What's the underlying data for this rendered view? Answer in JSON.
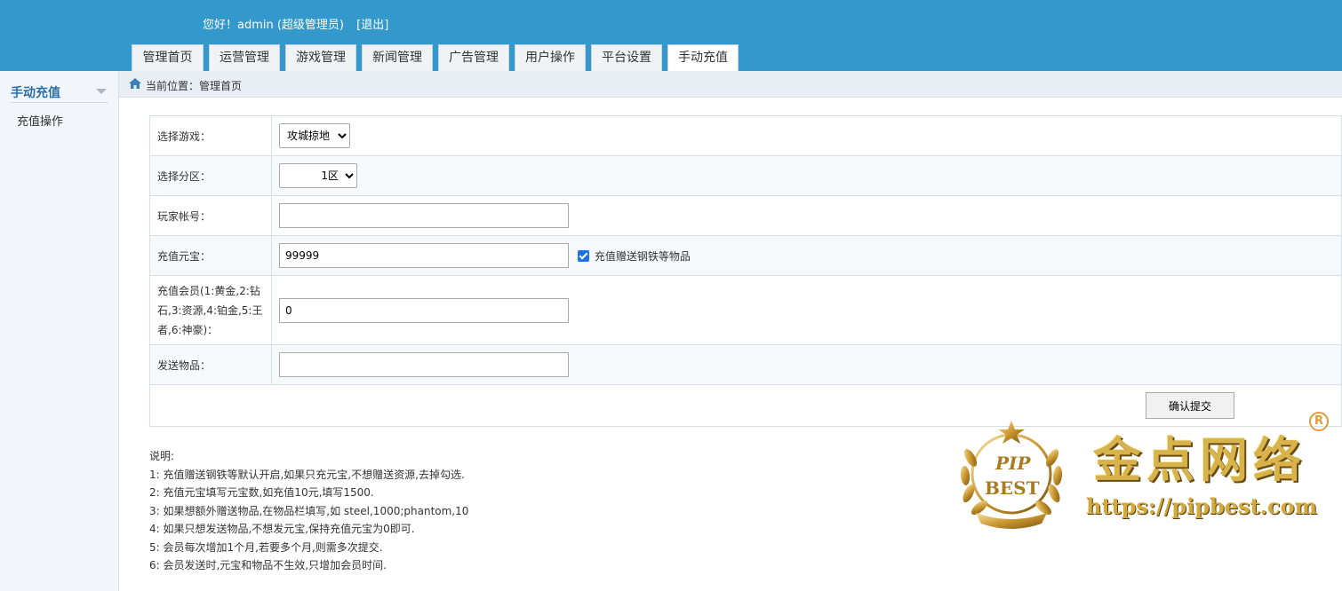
{
  "header": {
    "greeting": "您好！admin (超级管理员)",
    "logout": "[退出]"
  },
  "tabs": [
    {
      "label": "管理首页"
    },
    {
      "label": "运营管理"
    },
    {
      "label": "游戏管理"
    },
    {
      "label": "新闻管理"
    },
    {
      "label": "广告管理"
    },
    {
      "label": "用户操作"
    },
    {
      "label": "平台设置"
    },
    {
      "label": "手动充值"
    }
  ],
  "sidebar": {
    "title": "手动充值",
    "items": [
      {
        "label": "充值操作"
      }
    ]
  },
  "breadcrumb": {
    "text": "当前位置：管理首页"
  },
  "form": {
    "game_label": "选择游戏：",
    "game_value": "攻城掠地",
    "zone_label": "选择分区：",
    "zone_value": "1区",
    "account_label": "玩家帐号：",
    "account_value": "",
    "yuanbao_label": "充值元宝：",
    "yuanbao_value": "99999",
    "gift_checkbox_label": "充值赠送钢铁等物品",
    "gift_checked": true,
    "member_label": "充值会员(1:黄金,2:钻石,3:资源,4:铂金,5:王者,6:神豪)：",
    "member_value": "0",
    "items_label": "发送物品：",
    "items_value": "",
    "submit_label": "确认提交"
  },
  "notes": {
    "title": "说明:",
    "lines": [
      "1: 充值赠送钢铁等默认开启,如果只充元宝,不想赠送资源,去掉勾选.",
      "2: 充值元宝填写元宝数,如充值10元,填写1500.",
      "3: 如果想额外赠送物品,在物品栏填写,如 steel,1000;phantom,10",
      "4: 如果只想发送物品,不想发元宝,保持充值元宝为0即可.",
      "5: 会员每次增加1个月,若要多个月,则需多次提交.",
      "6: 会员发送时,元宝和物品不生效,只增加会员时间."
    ]
  },
  "watermark": {
    "seal_top": "PIP",
    "seal_bottom": "BEST",
    "brand": "金点网络",
    "url": "https://pipbest.com",
    "registered": "R"
  },
  "colors": {
    "header_bg": "#3399cc",
    "sidebar_title": "#2a6ea6",
    "checkbox": "#1a73e8"
  }
}
